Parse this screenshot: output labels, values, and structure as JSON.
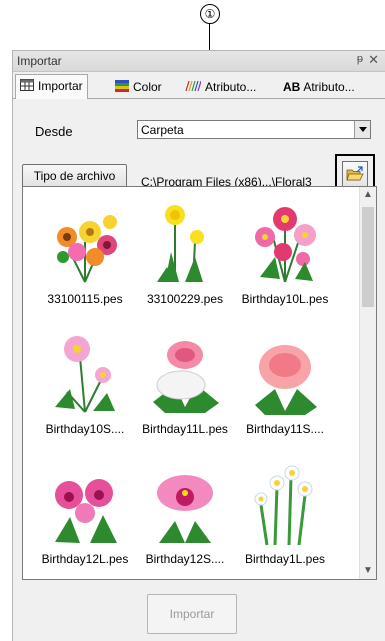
{
  "callout": {
    "number": "①"
  },
  "window": {
    "title": "Importar",
    "pin": "ᵽ",
    "close": "✕"
  },
  "tabs": [
    {
      "label": "Importar",
      "icon": "import-table-icon"
    },
    {
      "label": "Color",
      "icon": "color-icon"
    },
    {
      "label": "Atributo...",
      "icon": "stitch-attribute-icon"
    },
    {
      "label": "Atributo...",
      "icon_text": "AB"
    }
  ],
  "source": {
    "label": "Desde",
    "value": "Carpeta"
  },
  "file_type_button": "Tipo de archivo",
  "path": "C:\\Program Files (x86)...\\Floral3",
  "gallery": {
    "items": [
      {
        "label": "33100115.pes",
        "icon": "flower-bouquet-icon"
      },
      {
        "label": "33100229.pes",
        "icon": "dandelion-icon"
      },
      {
        "label": "Birthday10L.pes",
        "icon": "cosmos-bouquet-icon"
      },
      {
        "label": "Birthday10S....",
        "icon": "cosmos-icon"
      },
      {
        "label": "Birthday11L.pes",
        "icon": "chrysanthemum-bouquet-icon"
      },
      {
        "label": "Birthday11S....",
        "icon": "chrysanthemum-icon"
      },
      {
        "label": "Birthday12L.pes",
        "icon": "orchid-bouquet-icon"
      },
      {
        "label": "Birthday12S....",
        "icon": "orchid-icon"
      },
      {
        "label": "Birthday1L.pes",
        "icon": "narcissus-icon"
      }
    ]
  },
  "import_button": "Importar",
  "colors": {
    "panel_bg": "#f0f0f0",
    "disabled_text": "#9a9a9a"
  }
}
